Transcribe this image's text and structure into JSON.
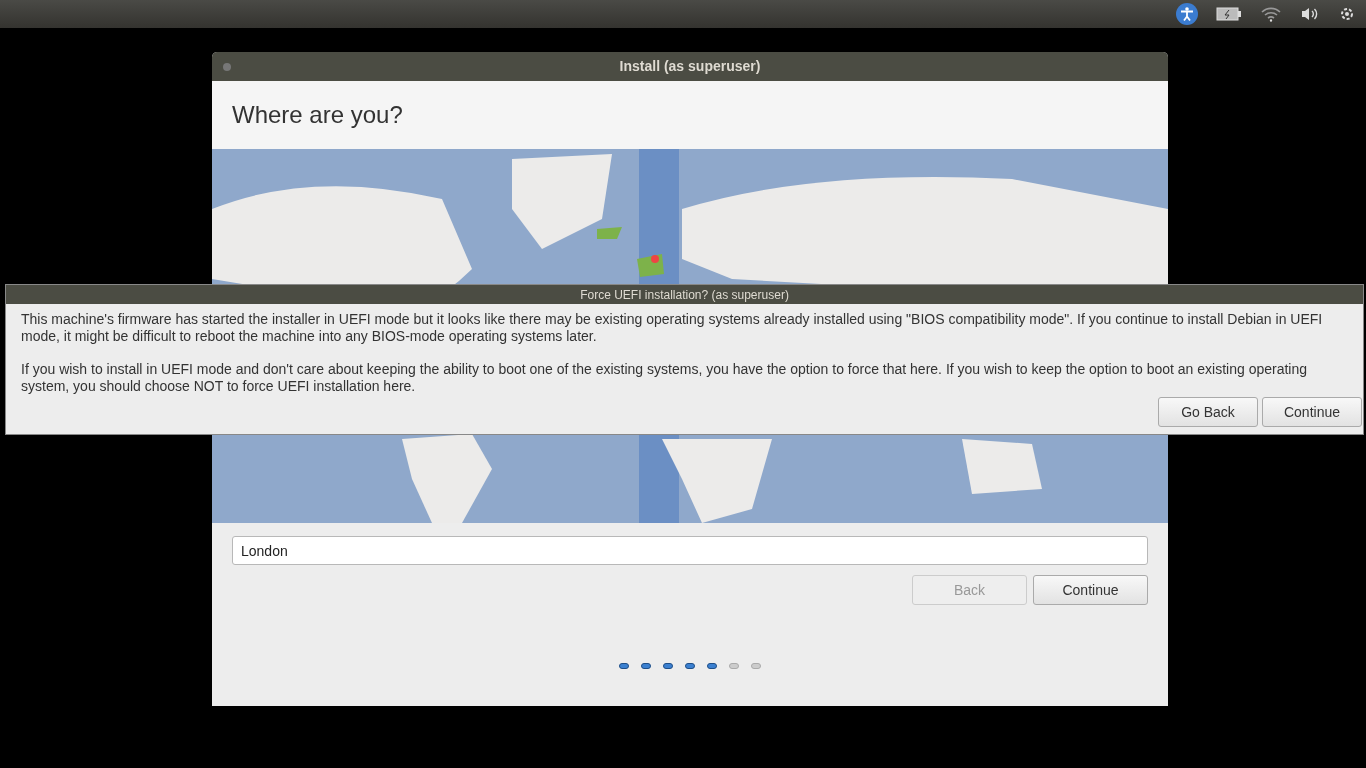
{
  "window": {
    "title": "Install (as superuser)"
  },
  "heading": "Where are you?",
  "location_field": {
    "value": "London"
  },
  "buttons": [
    {
      "label": "Back",
      "disabled": true
    },
    {
      "label": "Continue",
      "disabled": false
    }
  ],
  "progress": [
    {
      "done": true
    },
    {
      "done": true
    },
    {
      "done": true
    },
    {
      "done": true
    },
    {
      "done": true
    },
    {
      "done": false
    },
    {
      "done": false
    }
  ],
  "dialog": {
    "title": "Force UEFI installation? (as superuser)",
    "paragraphs": [
      "This machine's firmware has started the installer in UEFI mode but it looks like there may be existing operating systems already installed using \"BIOS compatibility mode\". If you continue to install Debian in UEFI mode, it might be difficult to reboot the machine into any BIOS-mode operating systems later.",
      "If you wish to install in UEFI mode and don't care about keeping the ability to boot one of the existing systems, you have the option to force that here. If you wish to keep the option to boot an existing operating system, you should choose NOT to force UEFI installation here."
    ],
    "buttons": [
      "Go Back",
      "Continue"
    ]
  }
}
